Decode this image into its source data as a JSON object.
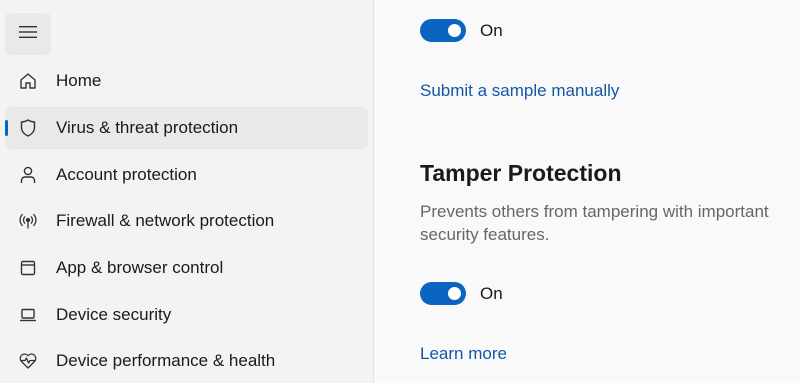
{
  "sidebar": {
    "menu_icon": "hamburger-menu-icon",
    "items": [
      {
        "label": "Home",
        "icon": "home-icon"
      },
      {
        "label": "Virus & threat protection",
        "icon": "shield-icon",
        "selected": true
      },
      {
        "label": "Account protection",
        "icon": "person-icon"
      },
      {
        "label": "Firewall & network protection",
        "icon": "wireless-antenna-icon"
      },
      {
        "label": "App & browser control",
        "icon": "app-window-icon"
      },
      {
        "label": "Device security",
        "icon": "laptop-icon"
      },
      {
        "label": "Device performance & health",
        "icon": "heart-pulse-icon"
      }
    ],
    "accent_color": "#0067c0"
  },
  "main": {
    "top_toggle": {
      "state": "On",
      "on": true
    },
    "submit_sample_link": "Submit a sample manually",
    "tamper": {
      "title": "Tamper Protection",
      "description": "Prevents others from tampering with important security features.",
      "toggle": {
        "state": "On",
        "on": true
      },
      "learn_more_link": "Learn more"
    },
    "toggle_color": "#0a65c2",
    "link_color": "#1456a8"
  }
}
